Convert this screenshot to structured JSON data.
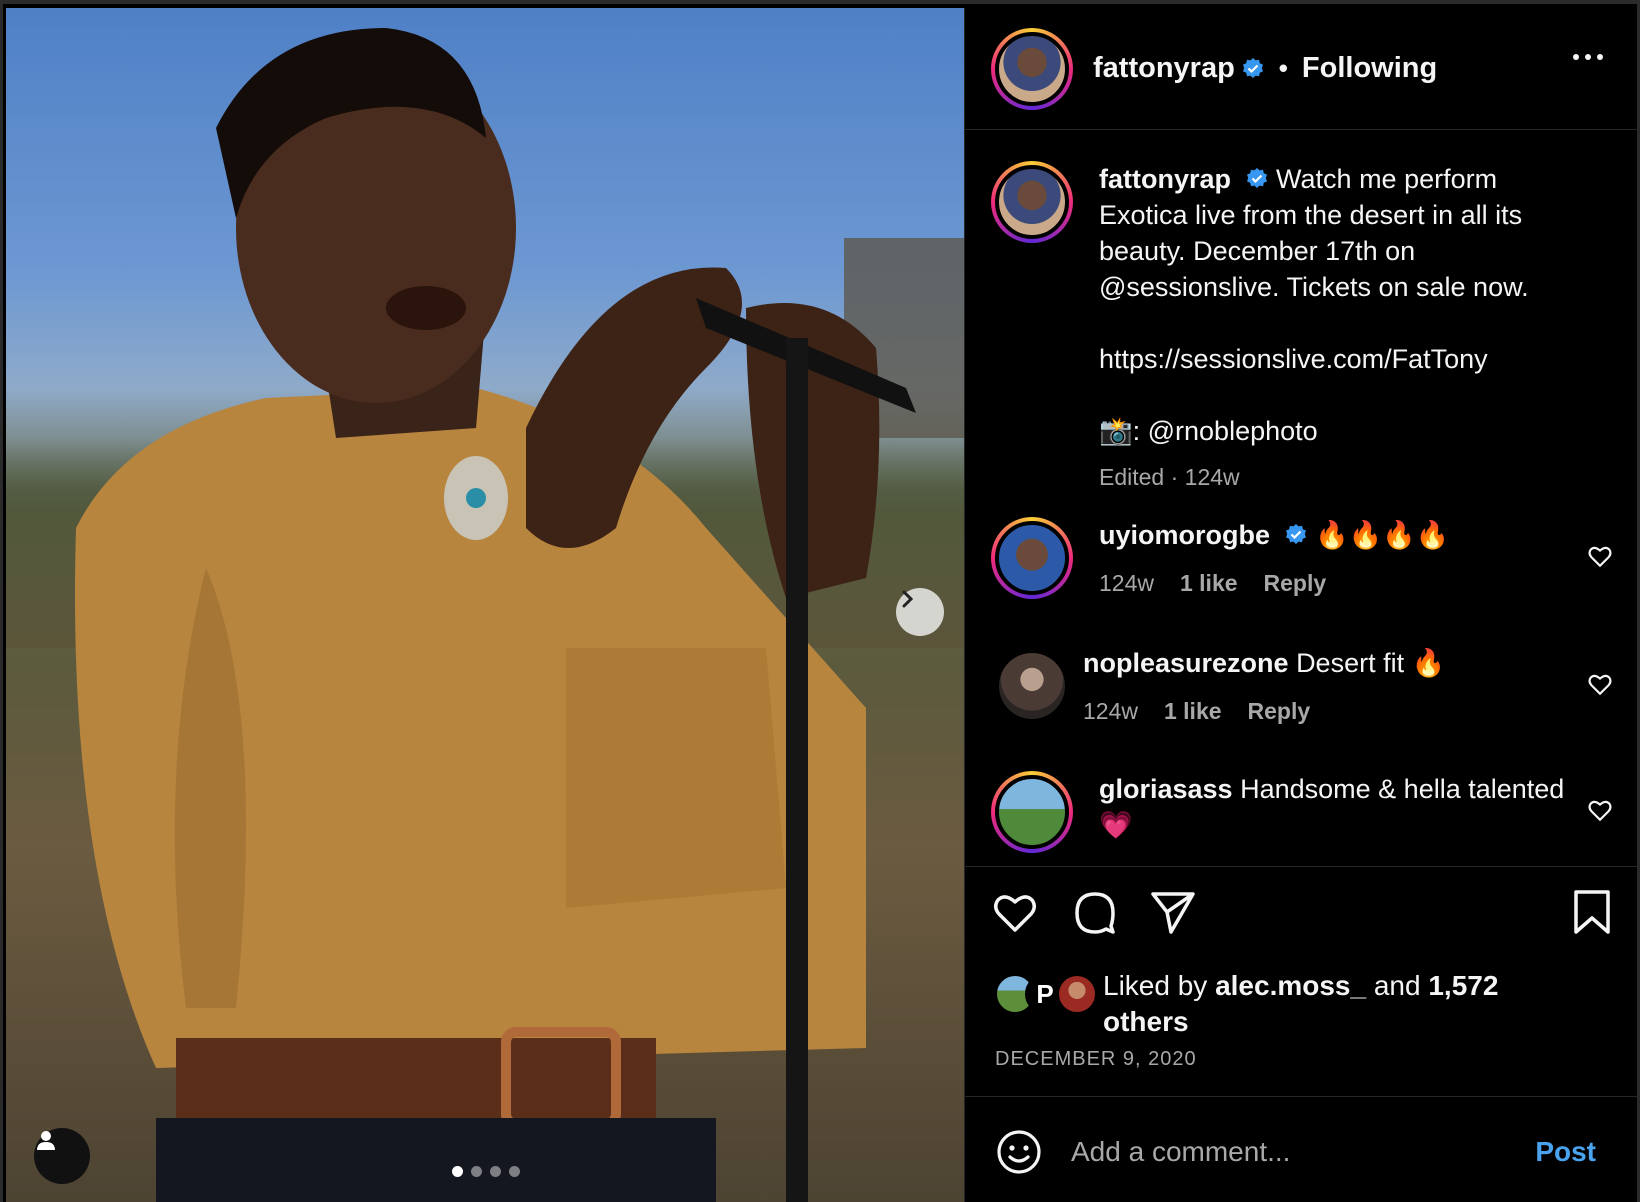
{
  "post": {
    "author": "fattonyrap",
    "follow_state": "Following",
    "separator": "•",
    "caption_text": "Watch me perform Exotica live from the desert in all its beauty. December 17th on @sessionslive. Tickets on sale now.",
    "caption_link": "https://sessionslive.com/FatTony",
    "caption_credit_icon": "📸",
    "caption_credit": ": @rnoblephoto",
    "caption_meta": "Edited · 124w",
    "icons": {
      "verified": "verified-badge-icon",
      "more": "more-options-icon",
      "next": "chevron-right-icon",
      "user_tag": "user-tag-icon"
    },
    "carousel": {
      "count": 4,
      "active": 1
    }
  },
  "comments": [
    {
      "user": "uyiomorogbe",
      "verified": true,
      "text": "🔥🔥🔥🔥",
      "age": "124w",
      "likes": "1 like",
      "reply": "Reply"
    },
    {
      "user": "nopleasurezone",
      "verified": false,
      "text": "Desert fit 🔥",
      "age": "124w",
      "likes": "1 like",
      "reply": "Reply"
    },
    {
      "user": "gloriasass",
      "verified": false,
      "text": "Handsome & hella talented 💗",
      "age": "",
      "likes": "",
      "reply": ""
    }
  ],
  "actions": {
    "like": "heart-icon",
    "comment": "comment-bubble-icon",
    "share": "send-plane-icon",
    "save": "bookmark-icon"
  },
  "likes": {
    "prefix": "Liked by",
    "user": "alec.moss_",
    "middle": "and",
    "count": "1,572",
    "suffix": "others"
  },
  "date": "DECEMBER 9, 2020",
  "add_comment": {
    "placeholder": "Add a comment...",
    "post_label": "Post",
    "emoji_icon": "emoji-smile-icon"
  },
  "colors": {
    "background": "#000000",
    "text": "#f5f5f5",
    "muted": "#a8a8a8",
    "link": "#4aa3ee",
    "verified": "#3897f0"
  }
}
